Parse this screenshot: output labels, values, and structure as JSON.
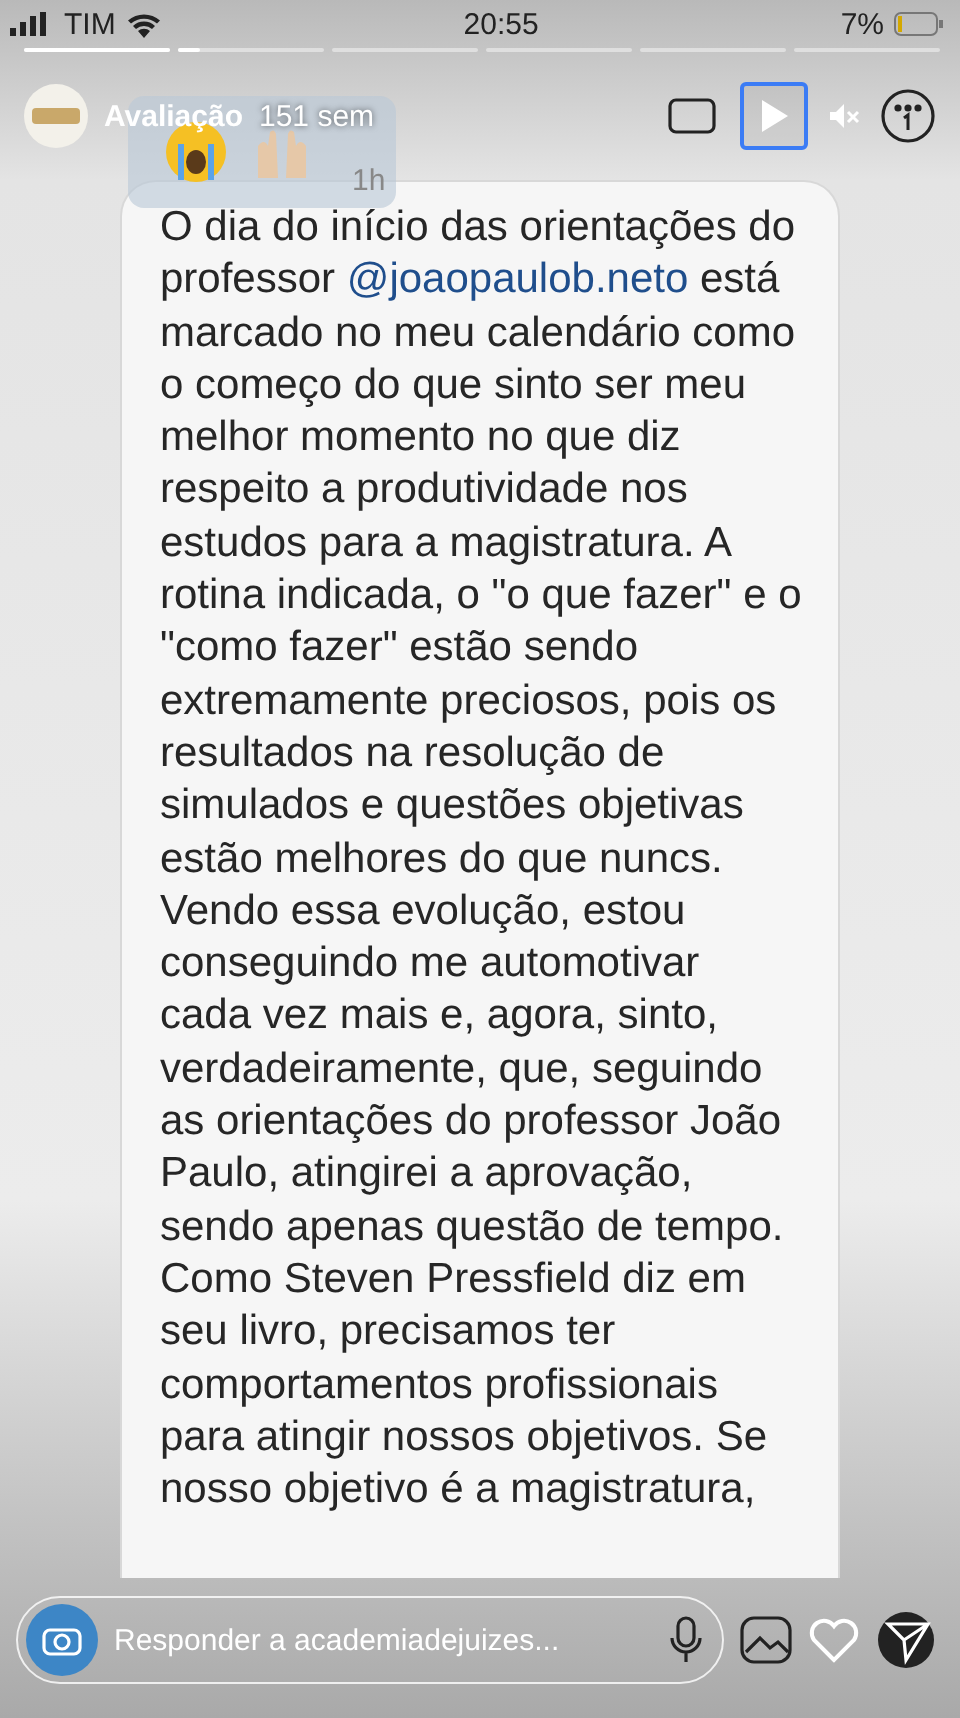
{
  "status_bar": {
    "carrier": "TIM",
    "time": "20:55",
    "battery": "7%"
  },
  "story_progress": [
    {
      "level": 1
    },
    {
      "level": 0.15
    },
    {
      "level": 0
    },
    {
      "level": 0
    },
    {
      "level": 0
    },
    {
      "level": 0
    }
  ],
  "header": {
    "title": "Avaliação",
    "age": "151 sem",
    "message_age": "1h"
  },
  "message": {
    "before": "O dia do início das orientações do professor ",
    "mention": "@joaopaulob.neto",
    "after": " está marcado no meu calendário como o começo do que sinto ser meu melhor momento no que diz respeito a produtividade nos estudos para a magistratura. A rotina indicada, o \"o que fazer\" e o \"como fazer\" estão sendo extremamente preciosos, pois os resultados na resolução de simulados e questões objetivas estão melhores do que nuncs. Vendo essa evolução, estou conseguindo me automotivar cada vez mais e, agora, sinto, verdadeiramente, que, seguindo as orientações do professor João Paulo, atingirei a aprovação, sendo apenas questão de tempo. Como Steven Pressfield diz em seu livro, precisamos ter comportamentos profissionais para atingir nossos objetivos. Se nosso objetivo é a magistratura,"
  },
  "reply": {
    "placeholder": "Responder a academiadejuizes..."
  }
}
